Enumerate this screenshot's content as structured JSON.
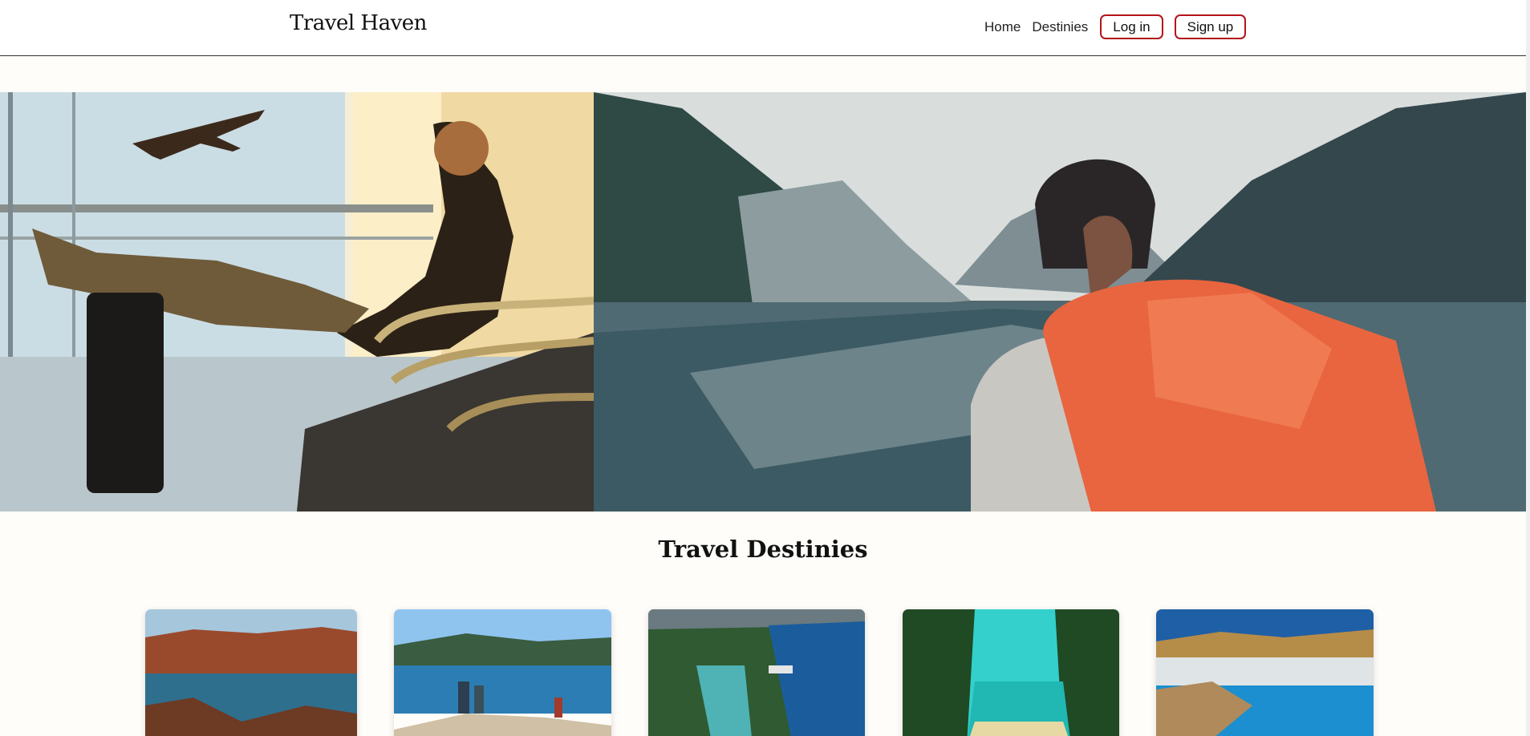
{
  "header": {
    "brand": "Travel Haven",
    "nav_links": [
      "Home",
      "Destinies"
    ],
    "login_label": "Log in",
    "signup_label": "Sign up"
  },
  "hero": {
    "images": [
      "airport-lounge-photo",
      "mountain-lake-backpacker-photo"
    ]
  },
  "destinies": {
    "title": "Travel Destinies",
    "cards": [
      "canyon-lake-photo",
      "family-lakeside-photo",
      "river-forest-aerial-photo",
      "tropical-beach-forest-photo",
      "coastal-town-photo"
    ]
  },
  "colors": {
    "accent_border": "#b3141a",
    "page_bg": "#fffdf9"
  }
}
